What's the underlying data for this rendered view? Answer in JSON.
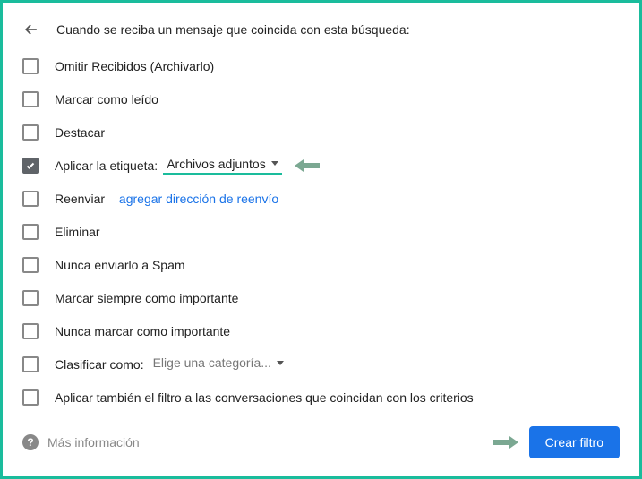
{
  "header": {
    "title": "Cuando se reciba un mensaje que coincida con esta búsqueda:"
  },
  "options": {
    "skip_inbox": {
      "label": "Omitir Recibidos (Archivarlo)",
      "checked": false
    },
    "mark_read": {
      "label": "Marcar como leído",
      "checked": false
    },
    "star": {
      "label": "Destacar",
      "checked": false
    },
    "apply_label": {
      "label": "Aplicar la etiqueta:",
      "checked": true,
      "dropdown": "Archivos adjuntos"
    },
    "forward": {
      "label": "Reenviar",
      "checked": false,
      "link": "agregar dirección de reenvío"
    },
    "delete": {
      "label": "Eliminar",
      "checked": false
    },
    "never_spam": {
      "label": "Nunca enviarlo a Spam",
      "checked": false
    },
    "always_important": {
      "label": "Marcar siempre como importante",
      "checked": false
    },
    "never_important": {
      "label": "Nunca marcar como importante",
      "checked": false
    },
    "categorize": {
      "label": "Clasificar como:",
      "checked": false,
      "dropdown": "Elige una categoría..."
    },
    "apply_matching": {
      "label": "Aplicar también el filtro a las conversaciones que coincidan con los criterios",
      "checked": false
    }
  },
  "footer": {
    "help": "Más información",
    "create": "Crear filtro"
  }
}
